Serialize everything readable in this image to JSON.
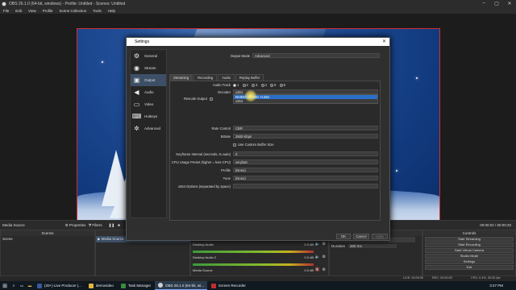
{
  "window": {
    "title": "OBS 26.1.0 (64-bit, windows) - Profile: Untitled - Scenes: Untitled"
  },
  "menu": [
    "File",
    "Edit",
    "View",
    "Profile",
    "Scene Collection",
    "Tools",
    "Help"
  ],
  "settings": {
    "title": "Settings",
    "sidebar": [
      {
        "label": "General",
        "icon": "gear-icon",
        "glyph": "⚙"
      },
      {
        "label": "Stream",
        "icon": "globe-icon",
        "glyph": "◉"
      },
      {
        "label": "Output",
        "icon": "monitor-icon",
        "glyph": "▣"
      },
      {
        "label": "Audio",
        "icon": "speaker-icon",
        "glyph": "◀"
      },
      {
        "label": "Video",
        "icon": "display-icon",
        "glyph": "▭"
      },
      {
        "label": "Hotkeys",
        "icon": "keyboard-icon",
        "glyph": "⌨"
      },
      {
        "label": "Advanced",
        "icon": "wrench-gear-icon",
        "glyph": "✲"
      }
    ],
    "active_sidebar_index": 2,
    "output_mode_label": "Output Mode",
    "output_mode_value": "Advanced",
    "tabs": [
      "Streaming",
      "Recording",
      "Audio",
      "Replay Buffer"
    ],
    "audio_track_label": "Audio Track",
    "audio_tracks": [
      "1",
      "2",
      "3",
      "4",
      "5",
      "6"
    ],
    "encoder_label": "Encoder",
    "encoder_value": "x264",
    "encoder_options": [
      "NVIDIA NVENC H.264",
      "x264"
    ],
    "rescale_label": "Rescale Output",
    "rate_control_label": "Rate Control",
    "rate_control_value": "CBR",
    "bitrate_label": "Bitrate",
    "bitrate_value": "2500 Kbps",
    "custom_buffer_label": "Use Custom Buffer Size",
    "keyframe_label": "Keyframe Interval (seconds, 0=auto)",
    "keyframe_value": "0",
    "cpu_preset_label": "CPU Usage Preset (higher = less CPU)",
    "cpu_preset_value": "veryfast",
    "profile_label": "Profile",
    "profile_value": "(None)",
    "tune_label": "Tune",
    "tune_value": "(None)",
    "x264_options_label": "x264 Options (separated by space)",
    "buttons": {
      "ok": "OK",
      "cancel": "Cancel",
      "apply": "Apply"
    }
  },
  "main": {
    "source_toolbar": {
      "source": "Media Source",
      "properties": "Properties",
      "filters": "Filters",
      "time": "00:00:02 / 00:00:20"
    },
    "docks": {
      "scenes": "Scenes",
      "sources": "Sources",
      "mixer": "Audio Mixer",
      "transitions": "Scene Transitions",
      "controls": "Controls"
    },
    "scene_item": "Scene",
    "source_item": "Media Source",
    "mixer_channels": [
      {
        "name": "Desktop Audio",
        "level": "0.0 dB"
      },
      {
        "name": "Desktop Audio 2",
        "level": "0.0 dB"
      },
      {
        "name": "Media Source",
        "level": "0.0 dB"
      }
    ],
    "transition": {
      "type": "Fade",
      "duration_label": "Duration",
      "duration_value": "300 ms"
    },
    "controls": [
      "Start Streaming",
      "Start Recording",
      "Start Virtual Camera",
      "Studio Mode",
      "Settings",
      "Exit"
    ],
    "status": {
      "live": "LIVE: 00:00:00",
      "rec": "REC: 00:00:00",
      "cpu": "CPU: 0.4%, 30.00 fps"
    }
  },
  "taskbar": {
    "items": [
      {
        "label": "(20+) Live Producer |...",
        "color": "#3b5998"
      },
      {
        "label": "demovideo",
        "color": "#e6b43c"
      },
      {
        "label": "Task Manager",
        "color": "#3c8c3c"
      },
      {
        "label": "OBS 26.1.0 (64-bit, wi...",
        "color": "#d0d0d0"
      },
      {
        "label": "Screen Recorder",
        "color": "#c03030"
      }
    ],
    "time": "3:27 PM"
  }
}
